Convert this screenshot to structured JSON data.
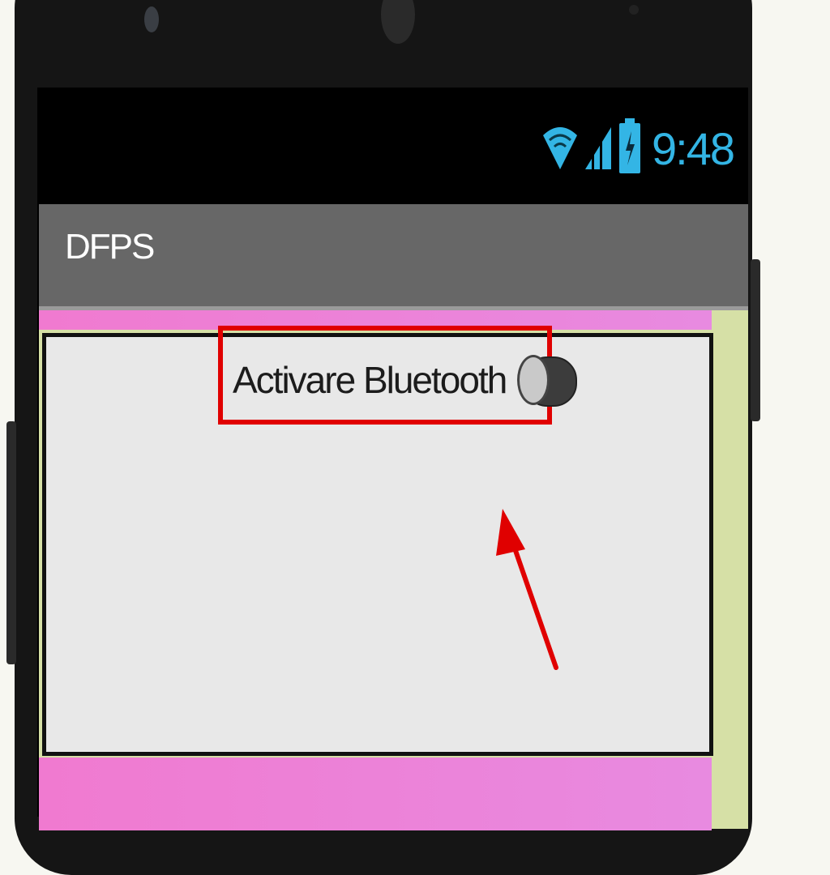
{
  "status_bar": {
    "time": "9:48",
    "icons": [
      "wifi-icon",
      "signal-icon",
      "battery-charging-icon"
    ],
    "icon_color": "#33b5e5"
  },
  "app": {
    "title": "DFPS",
    "action_bar_color": "#676767"
  },
  "content": {
    "bluetooth_label": "Activare Bluetooth",
    "bluetooth_switch_on": false,
    "highlight_color": "#e00000",
    "arrangement_color": "#e8e8e8",
    "pink_color": "#f07ad0",
    "side_color": "#d6e0a6"
  }
}
